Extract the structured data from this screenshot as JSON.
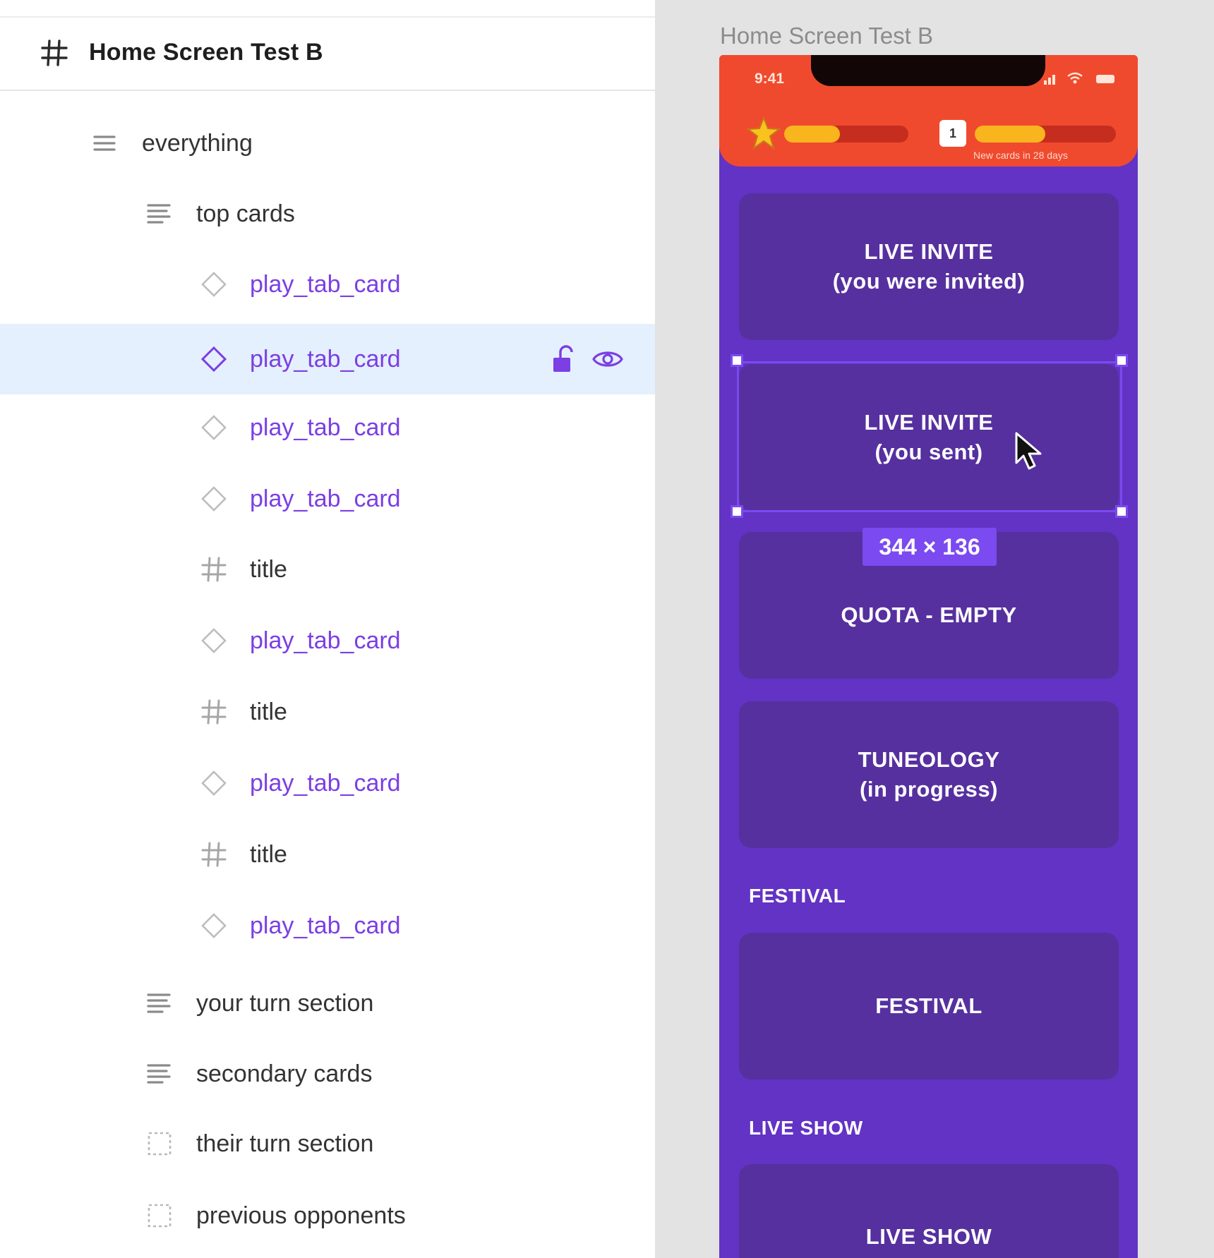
{
  "frame": {
    "name": "Home Screen Test B"
  },
  "layers": [
    {
      "label": "everything",
      "type": "auto-layout",
      "indent": 1
    },
    {
      "label": "top cards",
      "type": "auto-layout",
      "indent": 2
    },
    {
      "label": "play_tab_card",
      "type": "component",
      "indent": 3
    },
    {
      "label": "play_tab_card",
      "type": "component",
      "indent": 3,
      "selected": true
    },
    {
      "label": "play_tab_card",
      "type": "component",
      "indent": 3
    },
    {
      "label": "play_tab_card",
      "type": "component",
      "indent": 3
    },
    {
      "label": "title",
      "type": "frame",
      "indent": 3
    },
    {
      "label": "play_tab_card",
      "type": "component",
      "indent": 3
    },
    {
      "label": "title",
      "type": "frame",
      "indent": 3
    },
    {
      "label": "play_tab_card",
      "type": "component",
      "indent": 3
    },
    {
      "label": "title",
      "type": "frame",
      "indent": 3
    },
    {
      "label": "play_tab_card",
      "type": "component",
      "indent": 3
    },
    {
      "label": "your turn section",
      "type": "auto-layout",
      "indent": 2
    },
    {
      "label": "secondary cards",
      "type": "auto-layout",
      "indent": 2
    },
    {
      "label": "their turn section",
      "type": "group",
      "indent": 2
    },
    {
      "label": "previous opponents",
      "type": "group",
      "indent": 2
    }
  ],
  "canvas": {
    "frame_label": "Home Screen Test B",
    "dimension_badge": "344 × 136",
    "phone": {
      "time": "9:41",
      "level_box": "1",
      "tiny_text": "New cards in 28 days",
      "progress_1": 0.45,
      "progress_2": 0.5,
      "cards": [
        {
          "line1": "LIVE INVITE",
          "line2": "(you were invited)"
        },
        {
          "line1": "LIVE INVITE",
          "line2": "(you sent)"
        },
        {
          "line1": "QUOTA - EMPTY",
          "line2": ""
        },
        {
          "line1": "TUNEOLOGY",
          "line2": "(in progress)"
        },
        {
          "line1": "FESTIVAL",
          "line2": ""
        },
        {
          "line1": "LIVE SHOW",
          "line2": ""
        }
      ],
      "sections": [
        "FESTIVAL",
        "LIVE SHOW"
      ]
    }
  },
  "colors": {
    "accent": "#7b4af0",
    "component_text": "#7b3fe4",
    "selection_bg": "#e4f0fd",
    "phone_bg": "#6233c4",
    "header_bg": "#f04a2e"
  }
}
